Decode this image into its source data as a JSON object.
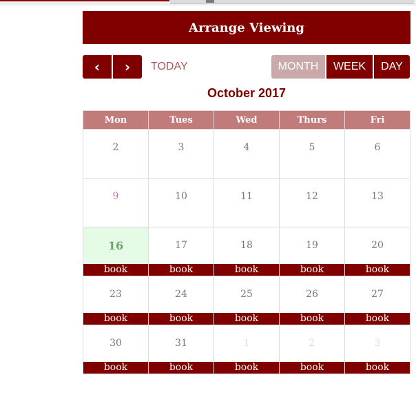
{
  "header": {
    "title": "Arrange Viewing"
  },
  "nav": {
    "prev_label": "‹",
    "next_label": "›",
    "today_label": "TODAY"
  },
  "views": {
    "month": "MONTH",
    "week": "WEEK",
    "day": "DAY",
    "active": "month"
  },
  "calendar": {
    "month_title": "October 2017",
    "days": [
      "Mon",
      "Tues",
      "Wed",
      "Thurs",
      "Fri"
    ],
    "book_label": "book",
    "weeks": [
      [
        {
          "n": "2"
        },
        {
          "n": "3"
        },
        {
          "n": "4"
        },
        {
          "n": "5"
        },
        {
          "n": "6"
        }
      ],
      [
        {
          "n": "9",
          "highlight": true
        },
        {
          "n": "10"
        },
        {
          "n": "11"
        },
        {
          "n": "12"
        },
        {
          "n": "13"
        }
      ],
      [
        {
          "n": "16",
          "today": true,
          "book": true
        },
        {
          "n": "17",
          "book": true
        },
        {
          "n": "18",
          "book": true
        },
        {
          "n": "19",
          "book": true
        },
        {
          "n": "20",
          "book": true
        }
      ],
      [
        {
          "n": "23",
          "book": true
        },
        {
          "n": "24",
          "book": true
        },
        {
          "n": "25",
          "book": true
        },
        {
          "n": "26",
          "book": true
        },
        {
          "n": "27",
          "book": true
        }
      ],
      [
        {
          "n": "30",
          "book": true
        },
        {
          "n": "31",
          "book": true
        },
        {
          "n": "1",
          "other": true,
          "book": true
        },
        {
          "n": "2",
          "other": true,
          "book": true
        },
        {
          "n": "3",
          "other": true,
          "book": true
        }
      ]
    ]
  },
  "colors": {
    "brand": "#800000",
    "header_row": "#c17b7b",
    "today_bg": "#e6fbe6"
  }
}
